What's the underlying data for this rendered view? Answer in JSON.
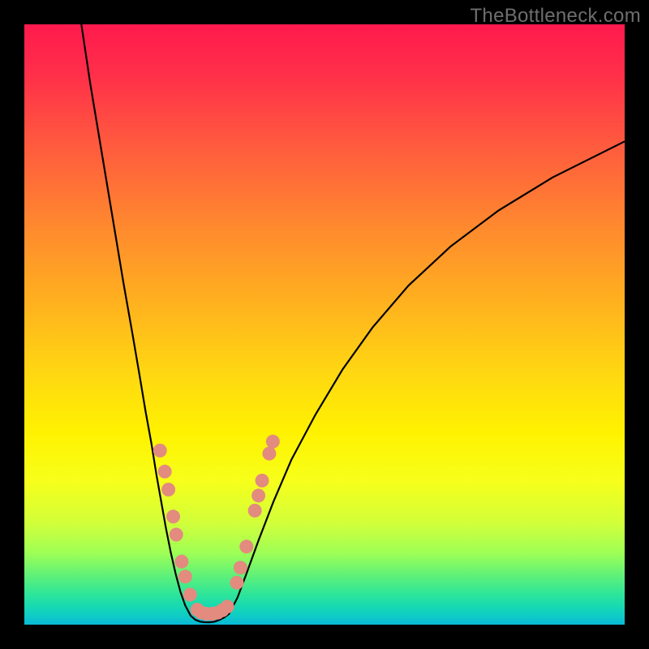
{
  "watermark": {
    "text": "TheBottleneck.com"
  },
  "colors": {
    "background": "#000000",
    "curve": "#000000",
    "marker_fill": "#e38b7f",
    "marker_stroke": "#c46a5c"
  },
  "chart_data": {
    "type": "line",
    "title": "",
    "xlabel": "",
    "ylabel": "",
    "xlim": [
      0,
      100
    ],
    "ylim": [
      0,
      100
    ],
    "grid": false,
    "legend": false,
    "notes": "Axes have no visible tick labels; values are normalized 0–100 in each direction. y=0 is bottom of the gradient area. Curve series are estimated from pixel positions.",
    "series": [
      {
        "name": "left-branch",
        "x": [
          9.5,
          11.0,
          13.0,
          15.0,
          16.5,
          18.0,
          19.2,
          20.2,
          21.2,
          22.0,
          22.8,
          23.6,
          24.4,
          25.2,
          26.0,
          26.8,
          27.7
        ],
        "y": [
          100.0,
          90.0,
          78.0,
          66.0,
          57.0,
          48.5,
          41.5,
          35.5,
          30.0,
          25.0,
          20.5,
          16.0,
          12.0,
          8.5,
          5.5,
          3.2,
          1.5
        ]
      },
      {
        "name": "valley-floor",
        "x": [
          27.7,
          28.5,
          29.3,
          30.1,
          30.9,
          31.7,
          32.5,
          33.3,
          34.1
        ],
        "y": [
          1.5,
          0.8,
          0.5,
          0.4,
          0.4,
          0.5,
          0.8,
          1.2,
          1.8
        ]
      },
      {
        "name": "right-branch",
        "x": [
          34.1,
          35.5,
          37.0,
          39.0,
          41.5,
          44.5,
          48.5,
          53.0,
          58.0,
          64.0,
          71.0,
          79.0,
          88.0,
          100.0
        ],
        "y": [
          1.8,
          4.5,
          8.5,
          14.0,
          20.5,
          27.5,
          35.0,
          42.5,
          49.5,
          56.5,
          63.0,
          69.0,
          74.5,
          80.5
        ]
      }
    ],
    "markers": {
      "name": "highlighted-points",
      "note": "Salmon-colored dots along the lower portion of the curve.",
      "points": [
        {
          "x": 22.6,
          "y": 29.0
        },
        {
          "x": 23.4,
          "y": 25.5
        },
        {
          "x": 24.0,
          "y": 22.5
        },
        {
          "x": 24.8,
          "y": 18.0
        },
        {
          "x": 25.3,
          "y": 15.0
        },
        {
          "x": 26.2,
          "y": 10.5
        },
        {
          "x": 26.8,
          "y": 8.0
        },
        {
          "x": 27.6,
          "y": 5.0
        },
        {
          "x": 28.8,
          "y": 2.5
        },
        {
          "x": 29.5,
          "y": 2.0
        },
        {
          "x": 30.4,
          "y": 1.8
        },
        {
          "x": 31.3,
          "y": 1.8
        },
        {
          "x": 32.2,
          "y": 2.0
        },
        {
          "x": 33.0,
          "y": 2.4
        },
        {
          "x": 33.8,
          "y": 3.0
        },
        {
          "x": 35.4,
          "y": 7.0
        },
        {
          "x": 36.0,
          "y": 9.5
        },
        {
          "x": 37.0,
          "y": 13.0
        },
        {
          "x": 38.4,
          "y": 19.0
        },
        {
          "x": 39.0,
          "y": 21.5
        },
        {
          "x": 39.6,
          "y": 24.0
        },
        {
          "x": 40.8,
          "y": 28.5
        },
        {
          "x": 41.4,
          "y": 30.5
        }
      ]
    }
  }
}
